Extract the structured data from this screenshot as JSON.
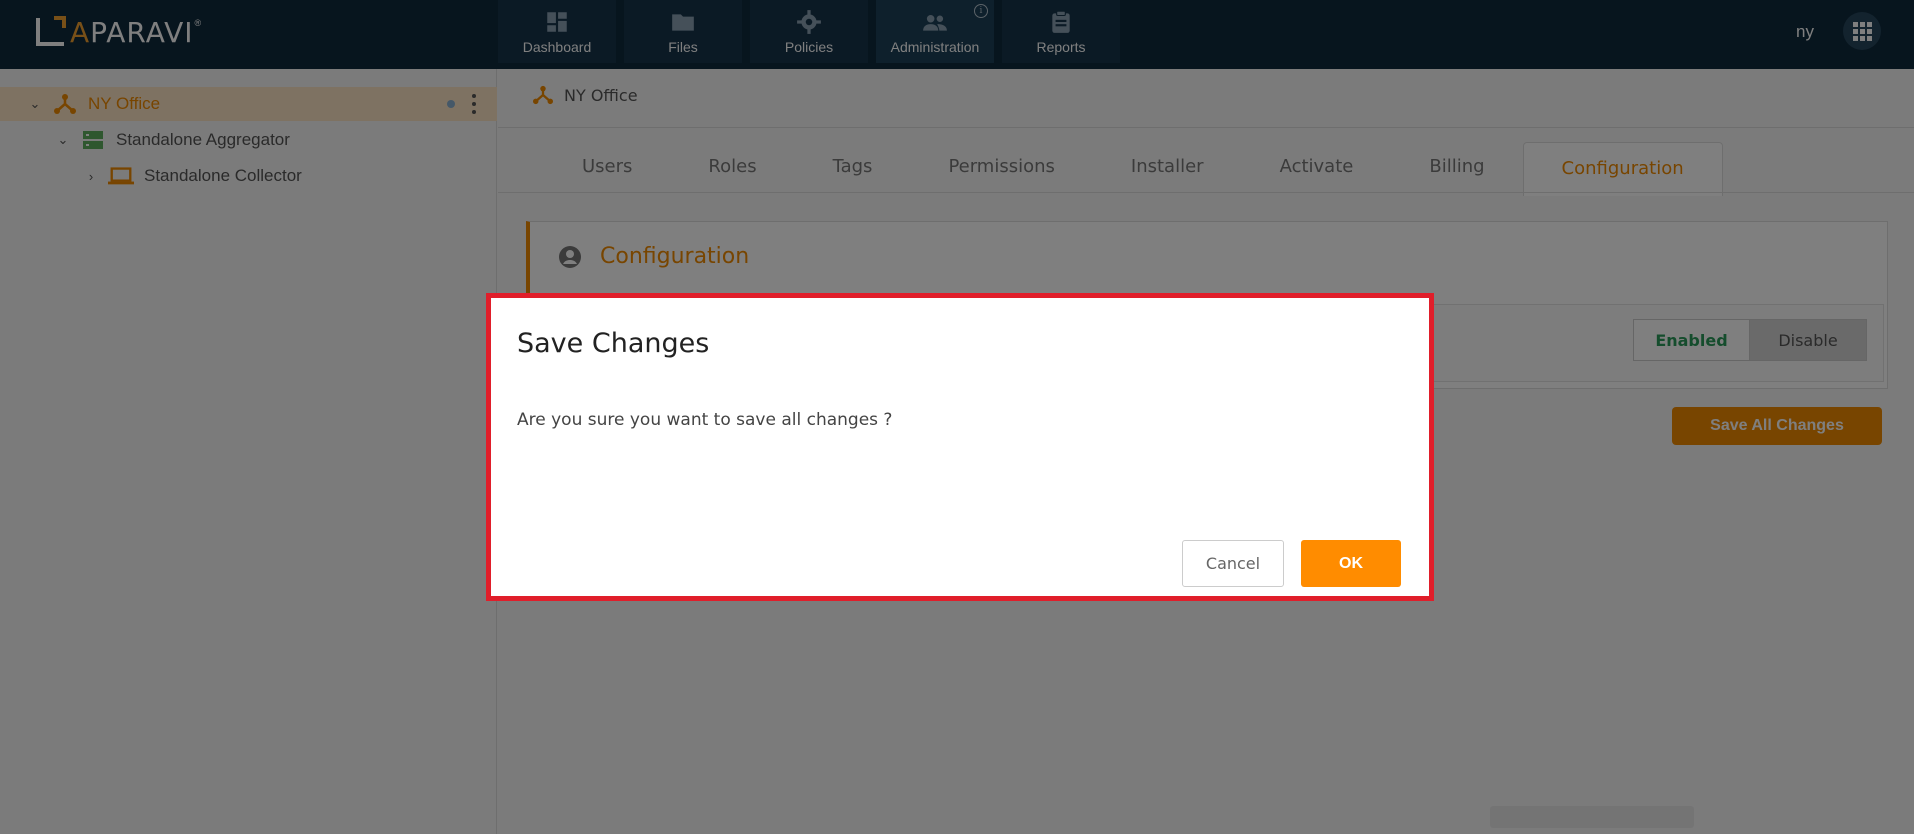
{
  "app": {
    "logo_text_a": "A",
    "logo_text_rest": "PARAVI",
    "logo_reg": "®"
  },
  "nav": {
    "tabs": [
      {
        "label": "Dashboard",
        "icon": "dashboard-icon"
      },
      {
        "label": "Files",
        "icon": "folder-icon"
      },
      {
        "label": "Policies",
        "icon": "gear-icon"
      },
      {
        "label": "Administration",
        "icon": "users-icon",
        "active": true
      },
      {
        "label": "Reports",
        "icon": "clipboard-icon"
      }
    ],
    "info_glyph": "i",
    "user_initials": "ny"
  },
  "tree": {
    "items": [
      {
        "label": "NY Office",
        "selected": true,
        "icon": "network-icon"
      },
      {
        "label": "Standalone Aggregator",
        "icon": "server-icon"
      },
      {
        "label": "Standalone Collector",
        "icon": "laptop-icon"
      }
    ]
  },
  "breadcrumb": {
    "label": "NY Office"
  },
  "subtabs": {
    "items": [
      "Users",
      "Roles",
      "Tags",
      "Permissions",
      "Installer",
      "Activate",
      "Billing",
      "Configuration"
    ],
    "active": "Configuration"
  },
  "config": {
    "title": "Configuration",
    "toggle_enabled": "Enabled",
    "toggle_disable": "Disable",
    "save_all_label": "Save All Changes"
  },
  "modal": {
    "title": "Save Changes",
    "body": "Are you sure you want to save all changes ?",
    "cancel_label": "Cancel",
    "ok_label": "OK"
  },
  "colors": {
    "topbar": "#0f2a3d",
    "accent": "#f08a00",
    "modal_border": "#e01e2a",
    "enabled_text": "#2a9a5a"
  }
}
